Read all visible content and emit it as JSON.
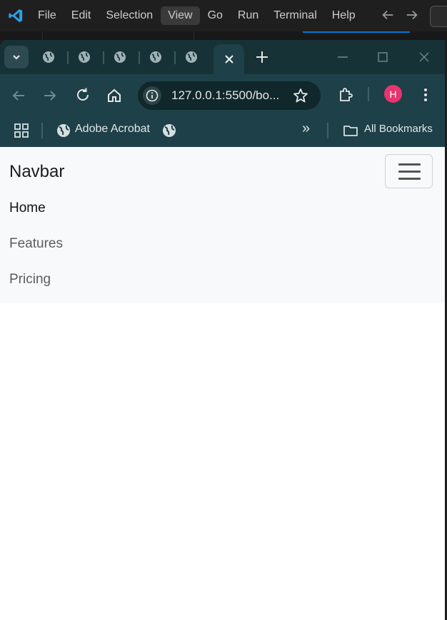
{
  "vscode": {
    "menu": [
      "File",
      "Edit",
      "Selection",
      "View",
      "Go",
      "Run",
      "Terminal",
      "Help"
    ],
    "active_menu_index": 3,
    "accent": "#0078d4"
  },
  "browser": {
    "tab_count": 6,
    "active_tab_close": "×",
    "address": "127.0.0.1:5500/bo...",
    "avatar_letter": "H",
    "avatar_color": "#e8346e",
    "bookmarks": {
      "adobe": "Adobe Acrobat",
      "all": "All Bookmarks",
      "overflow": "»"
    }
  },
  "page": {
    "brand": "Navbar",
    "links": [
      "Home",
      "Features",
      "Pricing"
    ],
    "navbar_bg": "#f8f9fa"
  }
}
